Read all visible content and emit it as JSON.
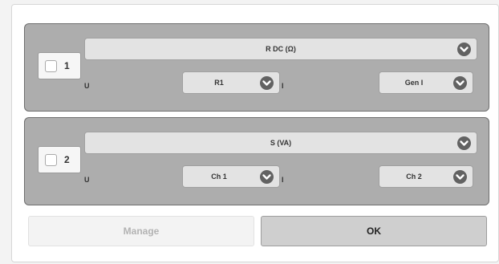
{
  "groups": [
    {
      "number": "1",
      "checked": false,
      "measurement": "R DC (Ω)",
      "u_label": "U",
      "u_value": "R1",
      "i_label": "I",
      "i_value": "Gen I"
    },
    {
      "number": "2",
      "checked": false,
      "measurement": "S (VA)",
      "u_label": "U",
      "u_value": "Ch 1",
      "i_label": "I",
      "i_value": "Ch 2"
    }
  ],
  "buttons": {
    "manage": "Manage",
    "ok": "OK"
  },
  "icons": {
    "dropdown": "chevron-down-icon"
  },
  "colors": {
    "group_bg": "#adadad",
    "select_bg": "#e3e3e3",
    "chevron_bg": "#626262"
  }
}
